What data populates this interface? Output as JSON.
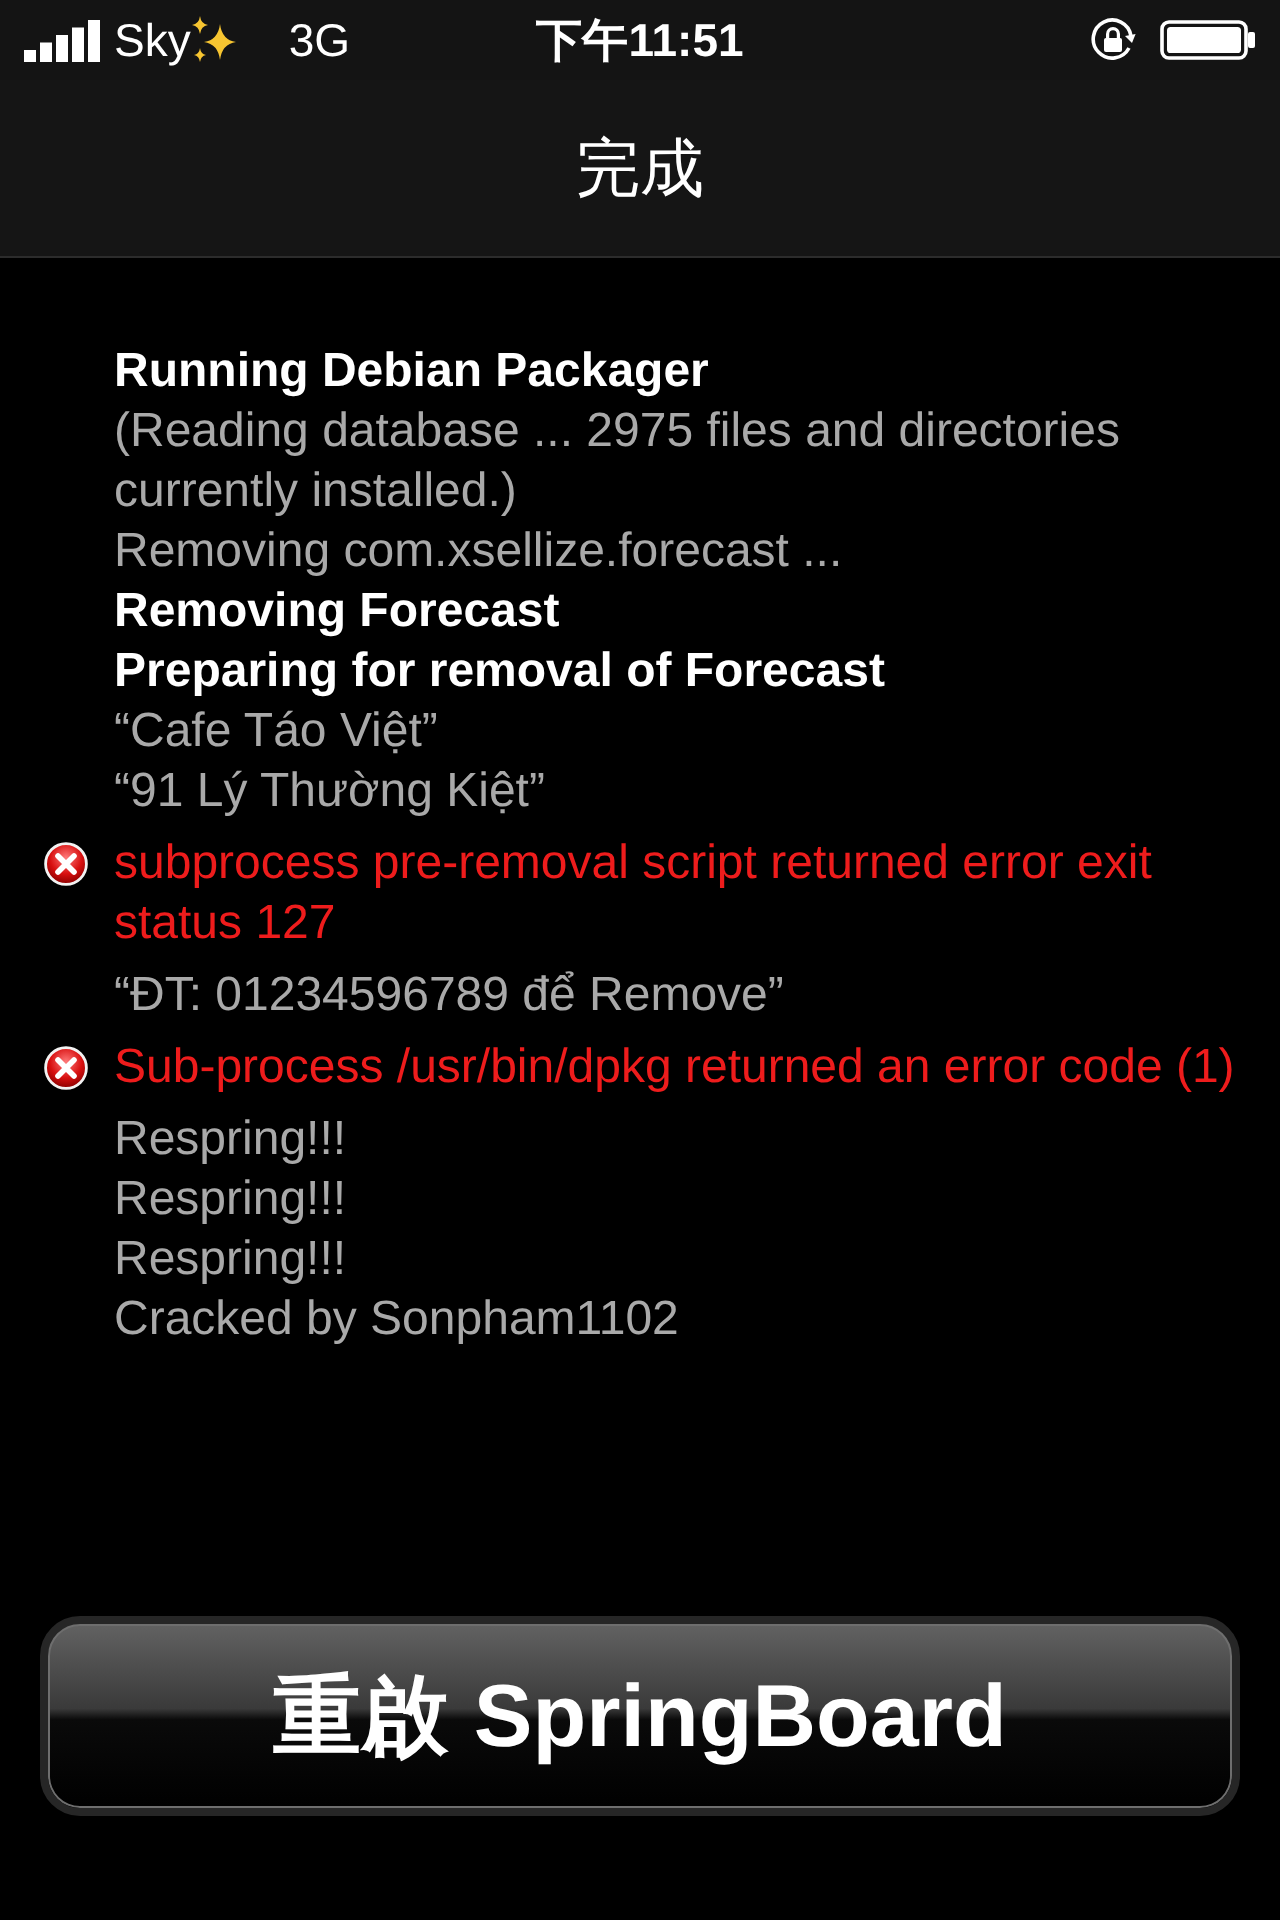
{
  "status_bar": {
    "carrier": "Sky",
    "network": "3G",
    "time": "下午11:51"
  },
  "nav_bar": {
    "title": "完成"
  },
  "log": [
    {
      "kind": "heading",
      "text": "Running Debian Packager"
    },
    {
      "kind": "info",
      "text": "(Reading database ... 2975 files and directories currently installed.)"
    },
    {
      "kind": "info",
      "text": "Removing com.xsellize.forecast ..."
    },
    {
      "kind": "heading",
      "text": "Removing Forecast"
    },
    {
      "kind": "heading",
      "text": "Preparing for removal of Forecast"
    },
    {
      "kind": "info",
      "text": "“Cafe Táo Việt”"
    },
    {
      "kind": "info",
      "text": "“91 Lý Thường Kiệt”"
    },
    {
      "kind": "error",
      "text": "subprocess pre-removal script returned error exit status 127"
    },
    {
      "kind": "info",
      "text": "“ĐT: 01234596789 để Remove”"
    },
    {
      "kind": "error",
      "text": "Sub-process /usr/bin/dpkg returned an error code (1)"
    },
    {
      "kind": "info",
      "text": "Respring!!!"
    },
    {
      "kind": "info",
      "text": "Respring!!!"
    },
    {
      "kind": "info",
      "text": "Respring!!!"
    },
    {
      "kind": "info",
      "text": "Cracked by Sonpham1102"
    }
  ],
  "button": {
    "label": "重啟 SpringBoard"
  }
}
